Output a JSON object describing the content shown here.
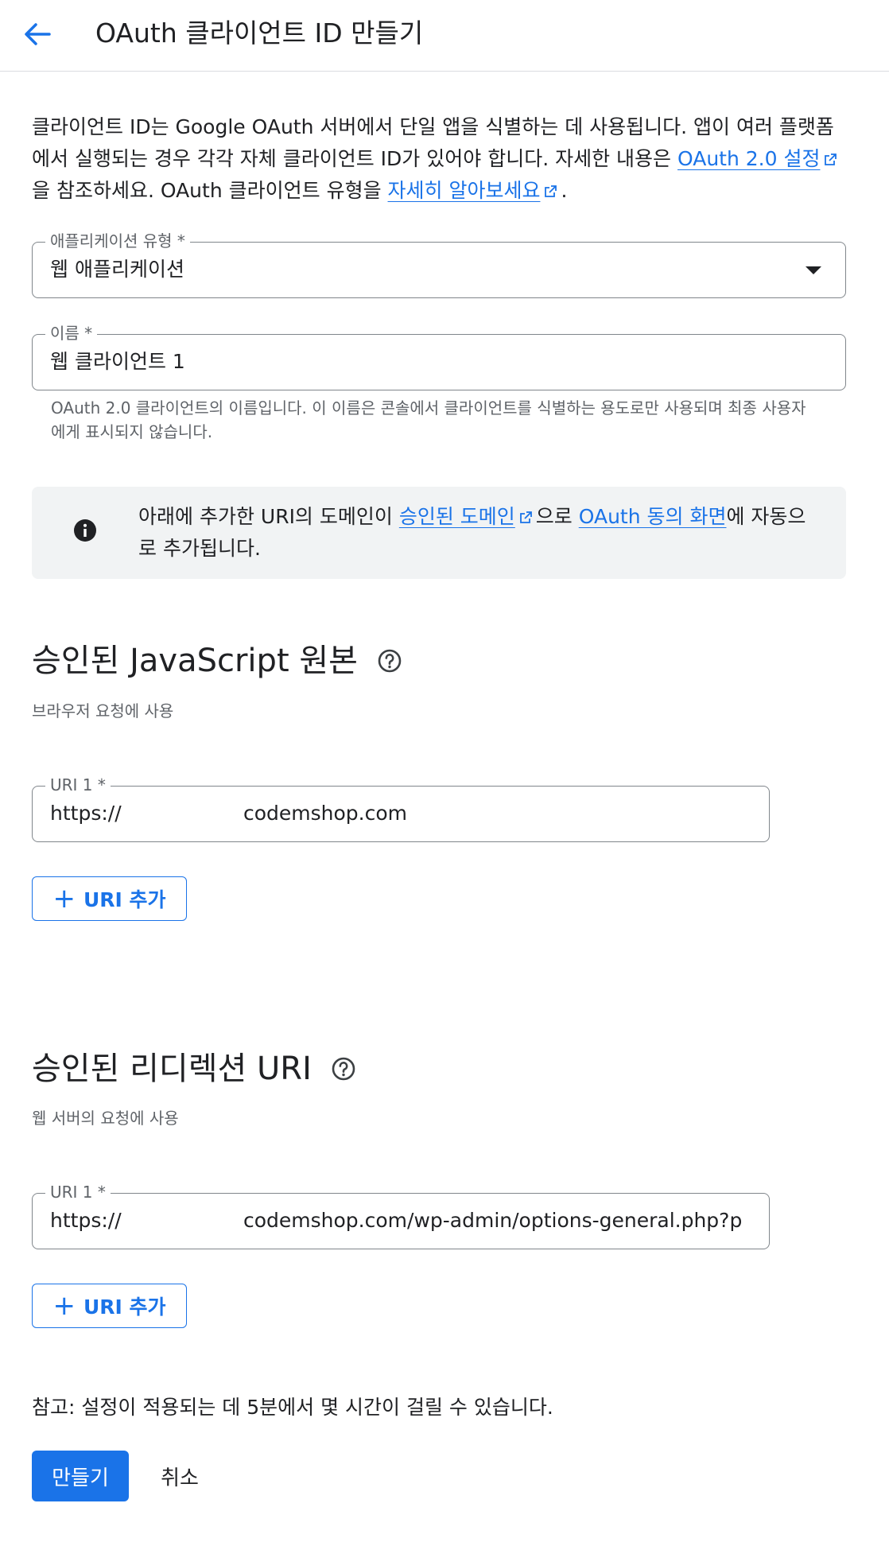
{
  "header": {
    "back_icon": "arrow-left-icon",
    "title": "OAuth 클라이언트 ID 만들기"
  },
  "description": {
    "text1": "클라이언트 ID는 Google OAuth 서버에서 단일 앱을 식별하는 데 사용됩니다. 앱이 여러 플랫폼에서 실행되는 경우 각각 자체 클라이언트 ID가 있어야 합니다. 자세한 내용은 ",
    "link1": "OAuth 2.0 설정",
    "text2": "을 참조하세요. OAuth 클라이언트 유형을 ",
    "link2": "자세히 알아보세요",
    "text3": "."
  },
  "app_type": {
    "label": "애플리케이션 유형 *",
    "value": "웹 애플리케이션"
  },
  "name_field": {
    "label": "이름 *",
    "value": "웹 클라이언트 1",
    "helper": "OAuth 2.0 클라이언트의 이름입니다. 이 이름은 콘솔에서 클라이언트를 식별하는 용도로만 사용되며 최종 사용자에게 표시되지 않습니다."
  },
  "info": {
    "icon": "info-icon",
    "text1": "아래에 추가한 URI의 도메인이 ",
    "link1": "승인된 도메인",
    "text2": "으로 ",
    "link2": "OAuth 동의 화면",
    "text3": "에 자동으로 추가됩니다."
  },
  "js_origins": {
    "title": "승인된 JavaScript 원본",
    "subtitle": "브라우저 요청에 사용",
    "uri_label": "URI 1 *",
    "uri_prefix": "https://",
    "uri_rest": "codemshop.com",
    "add_label": "URI 추가"
  },
  "redirect_uris": {
    "title": "승인된 리디렉션 URI",
    "subtitle": "웹 서버의 요청에 사용",
    "uri_label": "URI 1 *",
    "uri_prefix": "https://",
    "uri_rest": "codemshop.com/wp-admin/options-general.php?p",
    "add_label": "URI 추가"
  },
  "note": "참고: 설정이 적용되는 데 5분에서 몇 시간이 걸릴 수 있습니다.",
  "actions": {
    "create": "만들기",
    "cancel": "취소"
  },
  "colors": {
    "accent": "#1a73e8",
    "info_bg": "#f1f3f4",
    "border": "#80868b"
  }
}
